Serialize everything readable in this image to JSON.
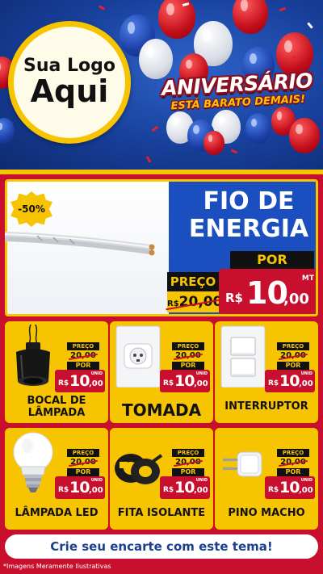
{
  "header": {
    "logo_line1": "Sua Logo",
    "logo_line2": "Aqui",
    "anniversary_title": "ANIVERSÁRIO",
    "anniversary_subtitle": "ESTÁ BARATO DEMAIS!"
  },
  "featured": {
    "discount_badge": "-50%",
    "title_line1": "FIO DE",
    "title_line2": "ENERGIA",
    "old_price_label": "PREÇO",
    "old_price": "20,00",
    "old_price_prefix": "R$",
    "new_price_label": "POR",
    "currency": "R$",
    "price_int": "10",
    "price_dec": ",00",
    "unit": "MT"
  },
  "products": [
    {
      "name": "BOCAL DE LÂMPADA",
      "old_label": "PREÇO",
      "old_price": "20,00",
      "por": "POR",
      "currency": "R$",
      "price_int": "10",
      "price_dec": ",00",
      "unit": "UNID"
    },
    {
      "name": "TOMADA",
      "old_label": "PREÇO",
      "old_price": "20,00",
      "por": "POR",
      "currency": "R$",
      "price_int": "10",
      "price_dec": ",00",
      "unit": "UNID"
    },
    {
      "name": "INTERRUPTOR",
      "old_label": "PREÇO",
      "old_price": "20,00",
      "por": "POR",
      "currency": "R$",
      "price_int": "10",
      "price_dec": ",00",
      "unit": "UNID"
    },
    {
      "name": "LÂMPADA LED",
      "old_label": "PREÇO",
      "old_price": "20,00",
      "por": "POR",
      "currency": "R$",
      "price_int": "10",
      "price_dec": ",00",
      "unit": "UNID"
    },
    {
      "name": "FITA ISOLANTE",
      "old_label": "PREÇO",
      "old_price": "20,00",
      "por": "POR",
      "currency": "R$",
      "price_int": "10",
      "price_dec": ",00",
      "unit": "UNID"
    },
    {
      "name": "PINO MACHO",
      "old_label": "PREÇO",
      "old_price": "20,00",
      "por": "POR",
      "currency": "R$",
      "price_int": "10",
      "price_dec": ",00",
      "unit": "UNID"
    }
  ],
  "footer": {
    "banner": "Crie seu encarte com este tema!",
    "disclaimer": "*Imagens Meramente Ilustrativas"
  },
  "colors": {
    "background_red": "#c8102e",
    "header_blue": "#1b4fbf",
    "accent_yellow": "#f6c400",
    "price_red": "#c8102e"
  }
}
